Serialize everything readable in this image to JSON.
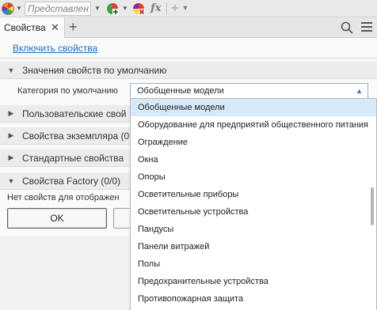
{
  "toolbar": {
    "view_select": "Представлен",
    "fx_label": "fx",
    "add_label": "+",
    "more_label": "▾"
  },
  "tabs": {
    "active_label": "Свойства",
    "close_glyph": "✕",
    "add_glyph": "+"
  },
  "panel": {
    "enable_link": "Включить свойства",
    "sections": [
      {
        "title": "Значения свойств по умолчанию",
        "expanded": true
      },
      {
        "title": "Пользовательские свой",
        "expanded": false
      },
      {
        "title": "Свойства экземпляра (0",
        "expanded": false
      },
      {
        "title": "Стандартные свойства",
        "expanded": false
      },
      {
        "title": "Свойства Factory (0/0)",
        "expanded": true
      }
    ],
    "category_label": "Категория по умолчанию",
    "category_value": "Обобщенные модели",
    "no_props_text": "Нет свойств для отображен",
    "ok_label": "OK",
    "cancel_label": ""
  },
  "dropdown": {
    "selected_index": 0,
    "items": [
      "Обобщенные модели",
      "Оборудование для предприятий общественного питания",
      "Ограждение",
      "Окна",
      "Опоры",
      "Осветительные приборы",
      "Осветительные устройства",
      "Пандусы",
      "Панели витражей",
      "Полы",
      "Предохранительные устройства",
      "Противопожарная защита"
    ]
  }
}
